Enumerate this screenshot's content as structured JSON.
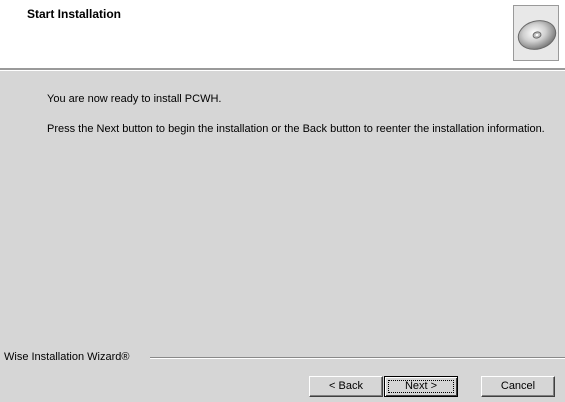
{
  "header": {
    "title": "Start Installation",
    "icon": "cd-disc-icon"
  },
  "main": {
    "ready_text": "You are now ready to install PCWH.",
    "instruction_text": "Press the Next button to begin the installation or the Back button to reenter the installation information."
  },
  "footer": {
    "brand": "Wise Installation Wizard®",
    "back_label": "< Back",
    "next_label": "Next >",
    "cancel_label": "Cancel"
  }
}
